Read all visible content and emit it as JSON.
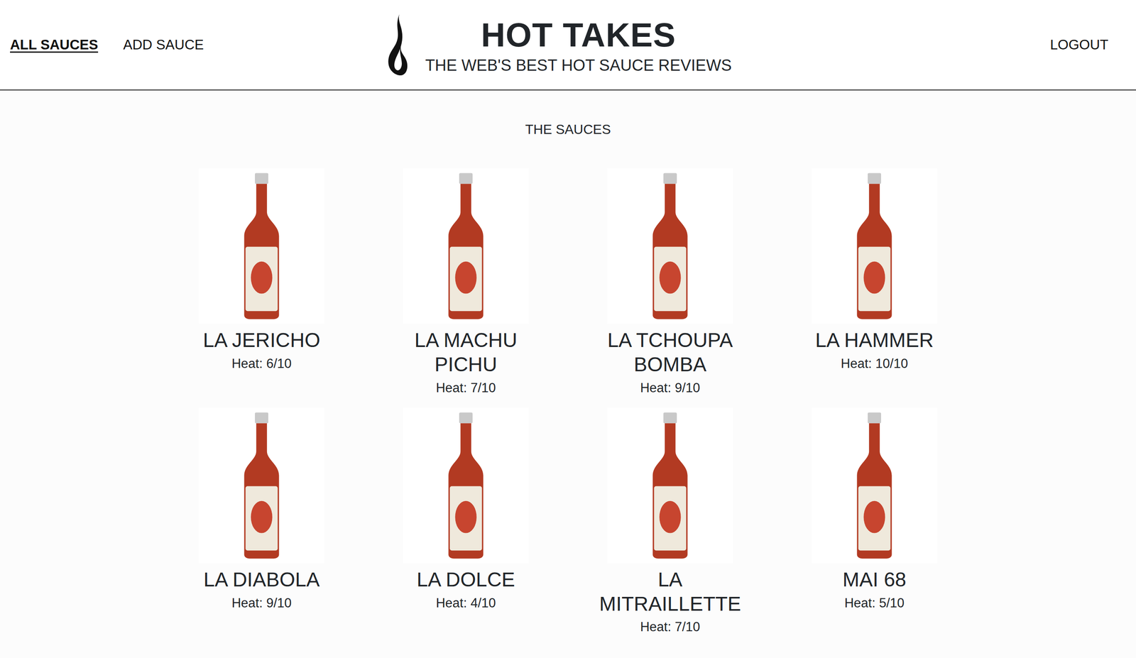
{
  "nav": {
    "items": [
      {
        "label": "ALL SAUCES",
        "selected": true
      },
      {
        "label": "ADD SAUCE",
        "selected": false
      }
    ],
    "logout": "LOGOUT"
  },
  "brand": {
    "title": "HOT TAKES",
    "subtitle": "THE WEB'S BEST HOT SAUCE REVIEWS"
  },
  "section_title": "THE SAUCES",
  "sauces": [
    {
      "name": "LA JERICHO",
      "heat": "Heat: 6/10"
    },
    {
      "name": "LA MACHU PICHU",
      "heat": "Heat: 7/10"
    },
    {
      "name": "LA TCHOUPA BOMBA",
      "heat": "Heat: 9/10"
    },
    {
      "name": "LA HAMMER",
      "heat": "Heat: 10/10"
    },
    {
      "name": "LA DIABOLA",
      "heat": "Heat: 9/10"
    },
    {
      "name": "LA DOLCE",
      "heat": "Heat: 4/10"
    },
    {
      "name": "LA MITRAILLETTE",
      "heat": "Heat: 7/10"
    },
    {
      "name": "MAI 68",
      "heat": "Heat: 5/10"
    }
  ]
}
